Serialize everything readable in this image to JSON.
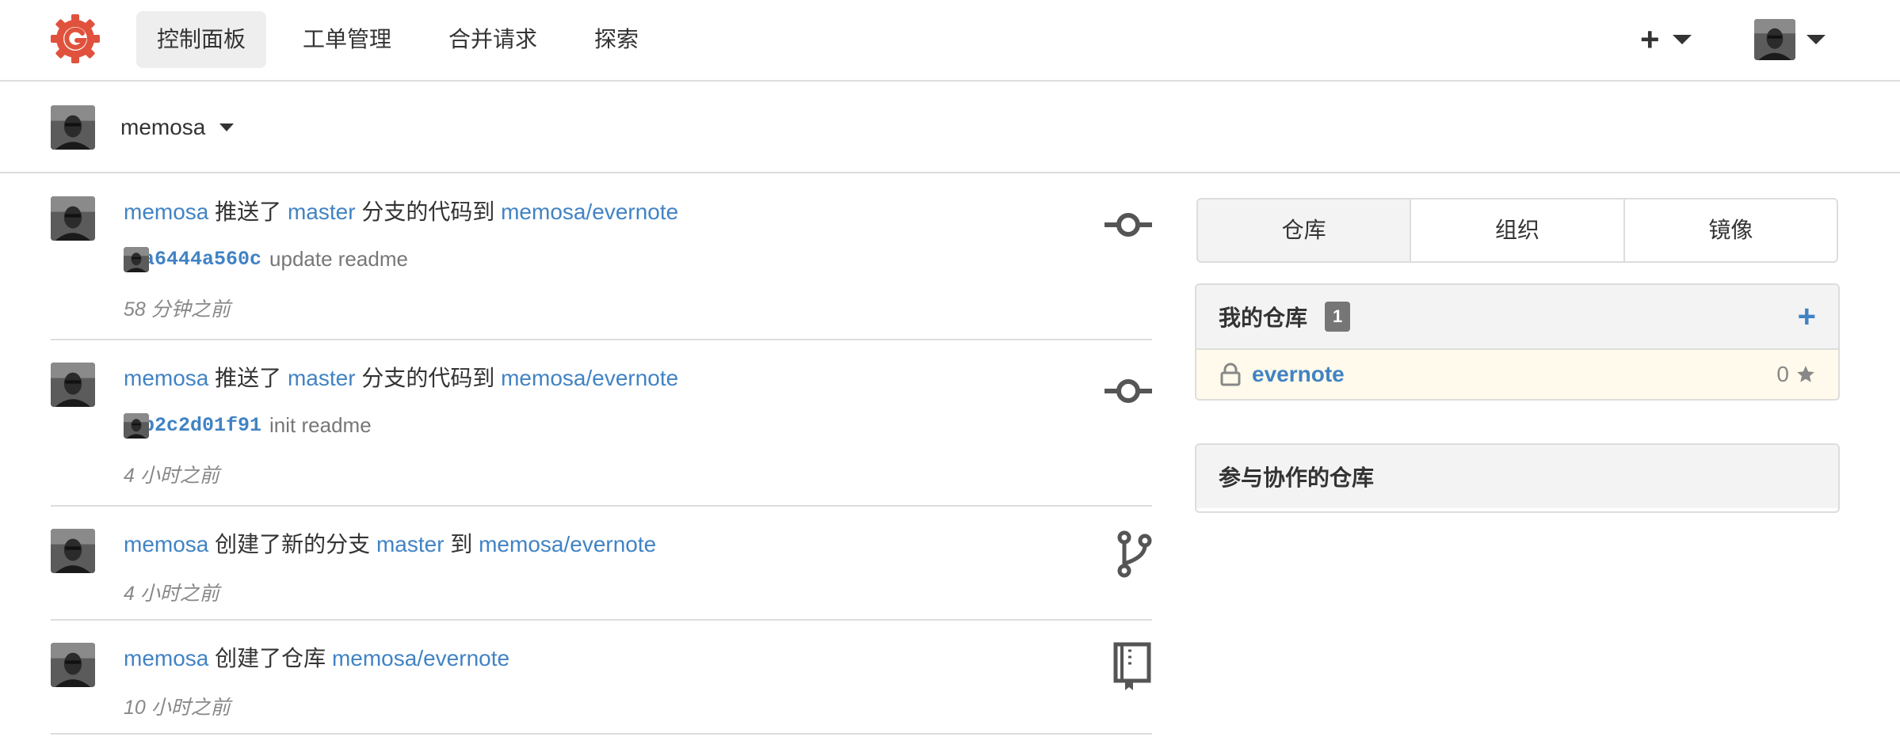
{
  "colors": {
    "brand": "#e0523d",
    "link": "#4183c4",
    "muted": "#888888",
    "border": "#dddddd"
  },
  "navbar": {
    "logo_icon": "gogs-logo-icon",
    "items": [
      {
        "label": "控制面板",
        "active": true
      },
      {
        "label": "工单管理",
        "active": false
      },
      {
        "label": "合并请求",
        "active": false
      },
      {
        "label": "探索",
        "active": false
      }
    ],
    "create_icon": "plus-icon",
    "user_menu_icon": "avatar"
  },
  "context": {
    "username": "memosa"
  },
  "feed": [
    {
      "type": "push",
      "icon": "git-commit-icon",
      "user": "memosa",
      "verb1": "推送了",
      "branch": "master",
      "verb2": "分支的代码到",
      "repo": "memosa/evernote",
      "commit": {
        "sha": "a6444a560c",
        "message": "update readme"
      },
      "time": "58 分钟之前"
    },
    {
      "type": "push",
      "icon": "git-commit-icon",
      "user": "memosa",
      "verb1": "推送了",
      "branch": "master",
      "verb2": "分支的代码到",
      "repo": "memosa/evernote",
      "commit": {
        "sha": "b2c2d01f91",
        "message": "init readme"
      },
      "time": "4 小时之前"
    },
    {
      "type": "branch",
      "icon": "git-branch-icon",
      "user": "memosa",
      "verb1": "创建了新的分支",
      "branch": "master",
      "verb2": "到",
      "repo": "memosa/evernote",
      "time": "4 小时之前"
    },
    {
      "type": "repo",
      "icon": "repo-icon",
      "user": "memosa",
      "verb1": "创建了仓库",
      "repo": "memosa/evernote",
      "time": "10 小时之前"
    }
  ],
  "sidebar": {
    "tabs": [
      {
        "label": "仓库",
        "active": true
      },
      {
        "label": "组织",
        "active": false
      },
      {
        "label": "镜像",
        "active": false
      }
    ],
    "my_repos": {
      "title": "我的仓库",
      "count": "1",
      "add_label": "+",
      "items": [
        {
          "name": "evernote",
          "private": true,
          "stars": "0"
        }
      ]
    },
    "collab_repos": {
      "title": "参与协作的仓库"
    }
  }
}
